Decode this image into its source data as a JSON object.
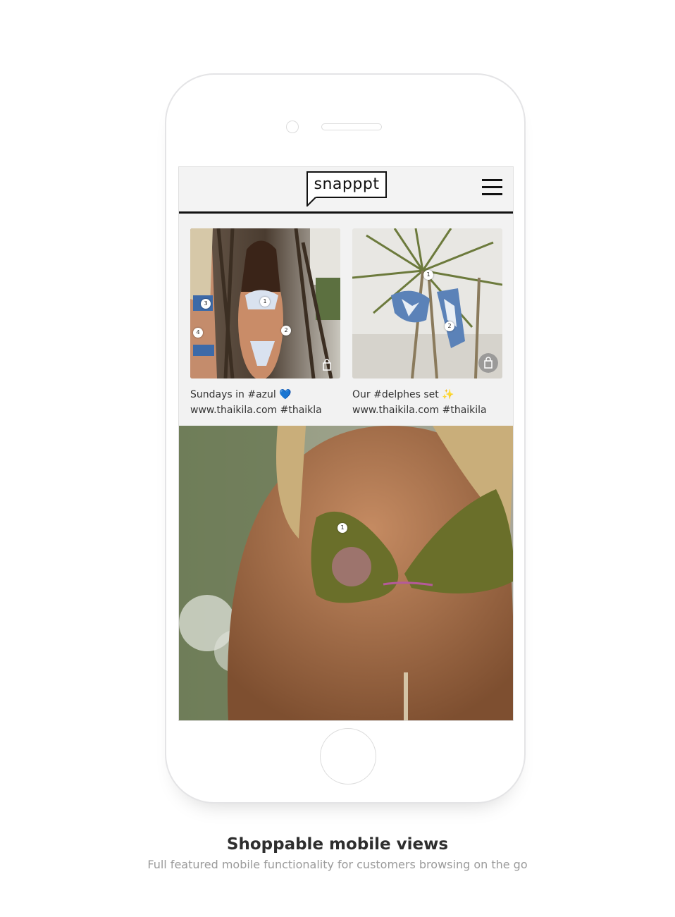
{
  "brand": {
    "logo_text": "snapppt"
  },
  "menu": {
    "icon": "hamburger-menu-icon"
  },
  "posts": [
    {
      "caption_line1": "Sundays in #azul 💙",
      "caption_line2": "www.thaikila.com #thaikla",
      "hotspots": [
        "1",
        "2",
        "3",
        "4"
      ]
    },
    {
      "caption_line1": "Our #delphes set ✨",
      "caption_line2": "www.thaikila.com #thaikila",
      "hotspots": [
        "1",
        "2"
      ]
    }
  ],
  "featured": {
    "hotspots": [
      "1"
    ]
  },
  "footer": {
    "title": "Shoppable mobile views",
    "subtitle": "Full featured mobile functionality for customers browsing on the go"
  },
  "colors": {
    "accent": "#111111",
    "screen_bg": "#f2f2f2",
    "subtitle": "#9a9a9a"
  }
}
